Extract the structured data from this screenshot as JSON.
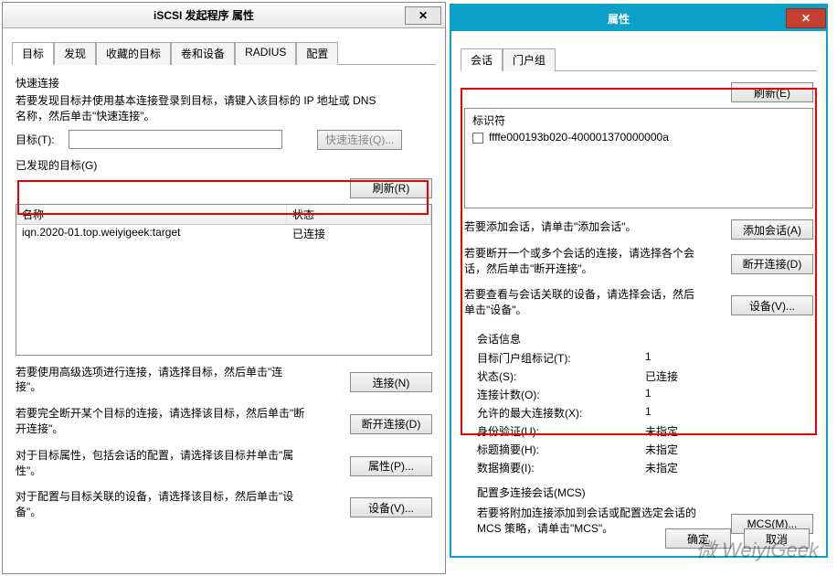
{
  "left": {
    "title": "iSCSI 发起程序 属性",
    "tabs": [
      "目标",
      "发现",
      "收藏的目标",
      "卷和设备",
      "RADIUS",
      "配置"
    ],
    "quick_title": "快速连接",
    "quick_hint": "若要发现目标并使用基本连接登录到目标，请键入该目标的 IP 地址或 DNS 名称，然后单击\"快速连接\"。",
    "target_label": "目标(T):",
    "quick_btn": "快速连接(Q)...",
    "discovered_label": "已发现的目标(G)",
    "refresh_btn": "刷新(R)",
    "col_name": "名称",
    "col_status": "状态",
    "row_name": "iqn.2020-01.top.weiyigeek:target",
    "row_status": "已连接",
    "adv_hint": "若要使用高级选项进行连接，请选择目标，然后单击\"连接\"。",
    "connect_btn": "连接(N)",
    "disc_hint": "若要完全断开某个目标的连接，请选择该目标，然后单击\"断开连接\"。",
    "disc_btn": "断开连接(D)",
    "prop_hint": "对于目标属性，包括会话的配置，请选择该目标并单击\"属性\"。",
    "prop_btn": "属性(P)...",
    "dev_hint": "对于配置与目标关联的设备，请选择该目标，然后单击\"设备\"。",
    "dev_btn": "设备(V)..."
  },
  "right": {
    "title": "属性",
    "tabs": [
      "会话",
      "门户组"
    ],
    "refresh_btn": "刷新(E)",
    "ident_label": "标识符",
    "ident_value": "ffffe000193b020-400001370000000a",
    "add_hint": "若要添加会话，请单击\"添加会话\"。",
    "add_btn": "添加会话(A)",
    "disconn_hint": "若要断开一个或多个会话的连接，请选择各个会话，然后单击\"断开连接\"。",
    "disconn_btn": "断开连接(D)",
    "devices_hint": "若要查看与会话关联的设备，请选择会话，然后单击\"设备\"。",
    "devices_btn": "设备(V)...",
    "info_title": "会话信息",
    "kv": {
      "portal_k": "目标门户组标记(T):",
      "portal_v": "1",
      "status_k": "状态(S):",
      "status_v": "已连接",
      "conn_k": "连接计数(O):",
      "conn_v": "1",
      "max_k": "允许的最大连接数(X):",
      "max_v": "1",
      "auth_k": "身份验证(U):",
      "auth_v": "未指定",
      "hdr_k": "标题摘要(H):",
      "hdr_v": "未指定",
      "data_k": "数据摘要(I):",
      "data_v": "未指定"
    },
    "mcs_title": "配置多连接会话(MCS)",
    "mcs_hint": "若要将附加连接添加到会话或配置选定会话的 MCS 策略，请单击\"MCS\"。",
    "mcs_btn": "MCS(M)...",
    "ok_btn": "确定",
    "cancel_btn": "取消"
  },
  "watermark": "微 WeiyiGeek"
}
